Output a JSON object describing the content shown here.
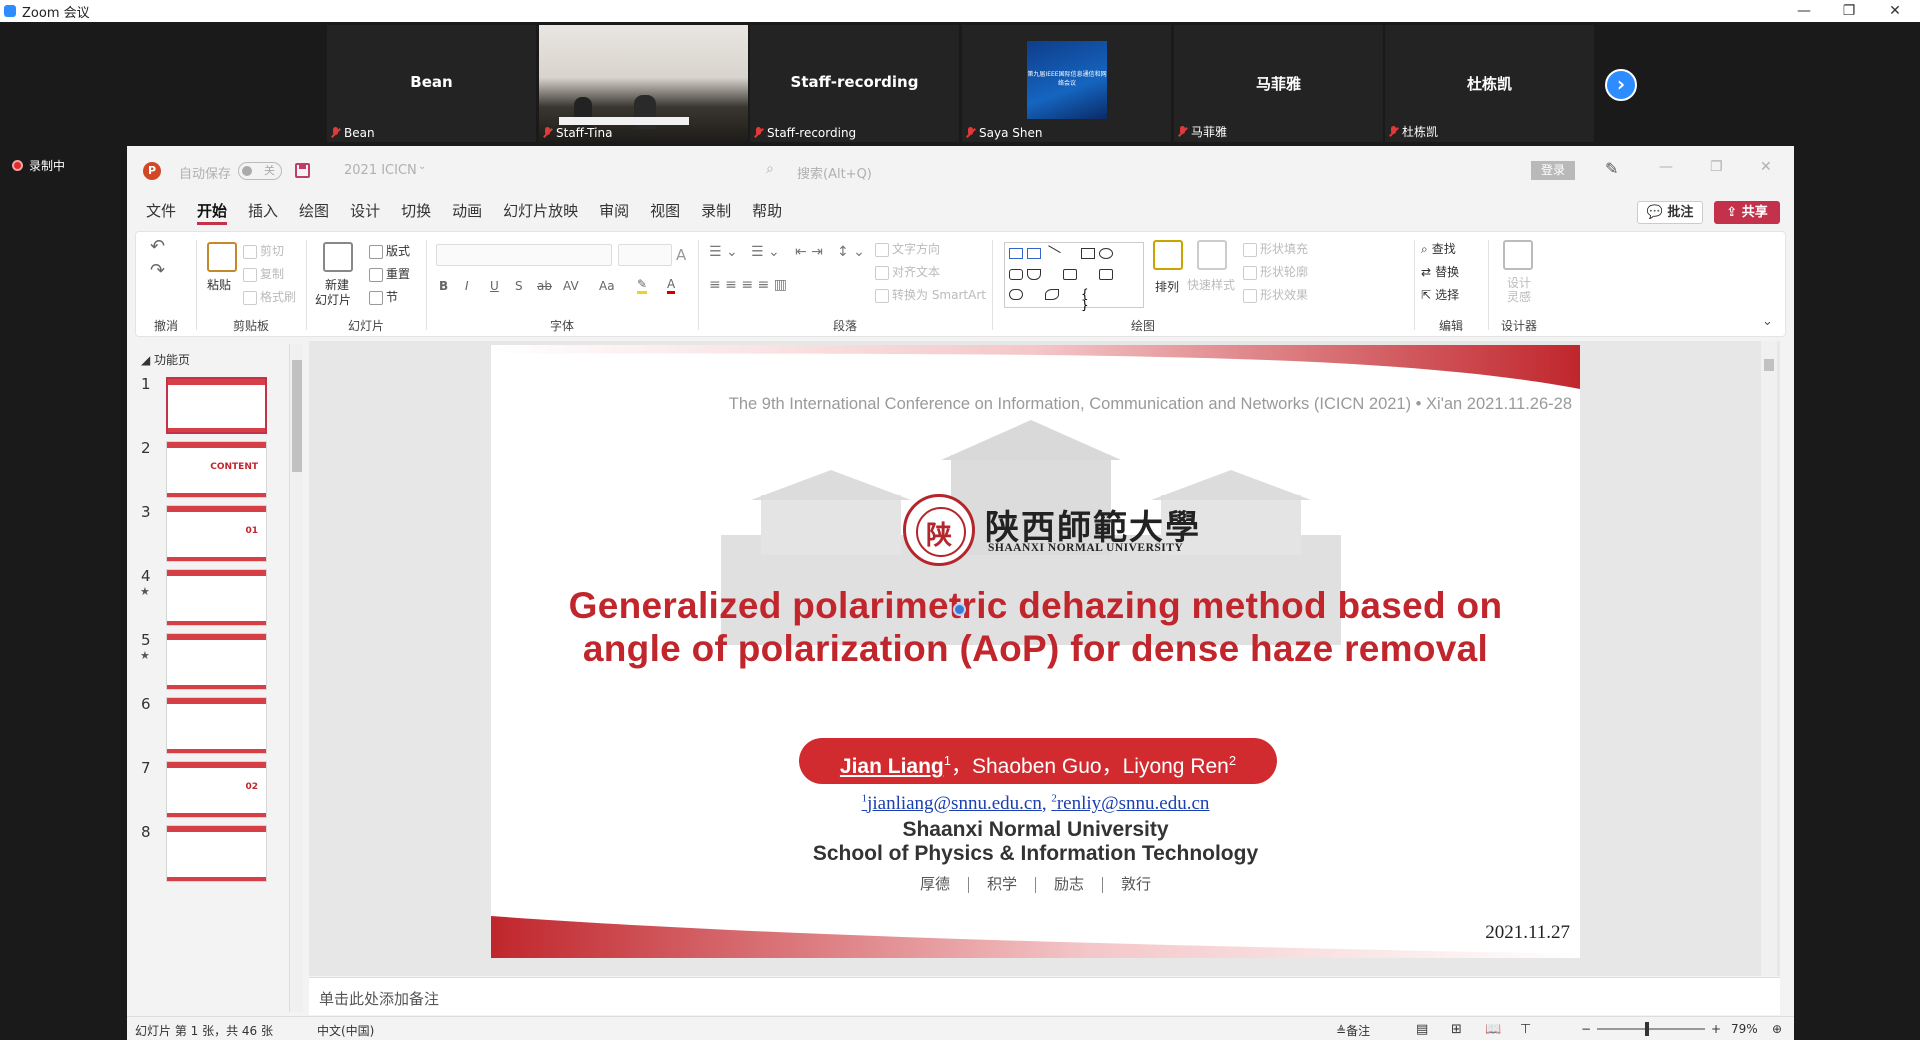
{
  "zoom": {
    "title": "Zoom 会议",
    "minimize": "—",
    "restore": "❐",
    "close": "✕",
    "recording_label": "录制中",
    "next_arrow": "›",
    "participants": [
      {
        "display": "Bean",
        "name": "Bean"
      },
      {
        "display": "",
        "name": "Staff-Tina"
      },
      {
        "display": "Staff-recording",
        "name": "Staff-recording"
      },
      {
        "display": "",
        "name": "Saya Shen",
        "thumb_text": "第九届IEEE国际信息通信和网络会议"
      },
      {
        "display": "马菲雅",
        "name": "马菲雅"
      },
      {
        "display": "杜栋凯",
        "name": "杜栋凯"
      }
    ]
  },
  "ppt": {
    "app_letter": "P",
    "autosave_label": "自动保存",
    "autosave_state": "关",
    "doc_name": "2021 ICICN",
    "search_placeholder": "搜索(Alt+Q)",
    "login": "登录",
    "menu": [
      "文件",
      "开始",
      "插入",
      "绘图",
      "设计",
      "切换",
      "动画",
      "幻灯片放映",
      "审阅",
      "视图",
      "录制",
      "帮助"
    ],
    "active_menu": "开始",
    "comment_btn": "批注",
    "share_btn": "共享",
    "ribbon": {
      "undo_group": "撤消",
      "clipboard": {
        "label": "剪贴板",
        "paste": "粘贴",
        "cut": "剪切",
        "copy": "复制",
        "format_painter": "格式刷"
      },
      "slides": {
        "label": "幻灯片",
        "new_slide_1": "新建",
        "new_slide_2": "幻灯片",
        "layout": "版式",
        "reset": "重置",
        "section": "节"
      },
      "font": {
        "label": "字体",
        "bold": "B",
        "italic": "I",
        "underline": "U",
        "strike": "S",
        "strike2": "ab",
        "spacing": "AV",
        "case": "Aa",
        "grow": "A",
        "shrink": "A"
      },
      "paragraph": {
        "label": "段落",
        "text_direction": "文字方向",
        "align_text": "对齐文本",
        "smartart": "转换为 SmartArt"
      },
      "drawing": {
        "label": "绘图",
        "arrange": "排列",
        "quick_styles": "快速样式",
        "shape_fill": "形状填充",
        "shape_outline": "形状轮廓",
        "shape_effects": "形状效果"
      },
      "editing": {
        "label": "编辑",
        "find": "查找",
        "replace": "替换",
        "select": "选择"
      },
      "designer": {
        "label": "设计器",
        "ideas_1": "设计",
        "ideas_2": "灵感"
      }
    },
    "thumbnails": {
      "section": "功能页",
      "items": [
        {
          "num": "1",
          "star": false,
          "text": ""
        },
        {
          "num": "2",
          "star": false,
          "text": "CONTENT"
        },
        {
          "num": "3",
          "star": false,
          "text": "01"
        },
        {
          "num": "4",
          "star": true,
          "text": ""
        },
        {
          "num": "5",
          "star": true,
          "text": ""
        },
        {
          "num": "6",
          "star": false,
          "text": ""
        },
        {
          "num": "7",
          "star": false,
          "text": "02"
        },
        {
          "num": "8",
          "star": false,
          "text": ""
        }
      ],
      "star_glyph": "★"
    },
    "slide": {
      "conference": "The 9th International Conference on Information, Communication and Networks (ICICN 2021) • Xi'an 2021.11.26-28",
      "univ_cn": "陕西師範大學",
      "univ_en": "SHAANXI NORMAL UNIVERSITY",
      "title_1": "Generalized polarimetric dehazing method based on",
      "title_2": "angle of polarization (AoP) for dense haze removal",
      "author_1": "Jian Liang",
      "author_1_sup": "1",
      "author_rest": "，Shaoben Guo，Liyong Ren",
      "author_rest_sup": "2",
      "email_1_sup": "1",
      "email_1": "jianliang@snnu.edu.cn",
      "email_sep": ", ",
      "email_2_sup": "2",
      "email_2": "renliy@snnu.edu.cn",
      "uni_en": "Shaanxi Normal University",
      "school": "School of Physics & Information Technology",
      "motto": [
        "厚德",
        "积学",
        "励志",
        "敦行"
      ],
      "date": "2021.11.27"
    },
    "notes_placeholder": "单击此处添加备注",
    "status": {
      "slide_count": "幻灯片 第 1 张，共 46 张",
      "language": "中文(中国)",
      "notes": "备注",
      "zoom_minus": "−",
      "zoom_plus": "+",
      "zoom": "79%"
    },
    "colors": {
      "accent": "#c4314b",
      "slide_red": "#c0262c",
      "author_pill": "#d12b30",
      "email_blue": "#1a3fb0"
    }
  }
}
